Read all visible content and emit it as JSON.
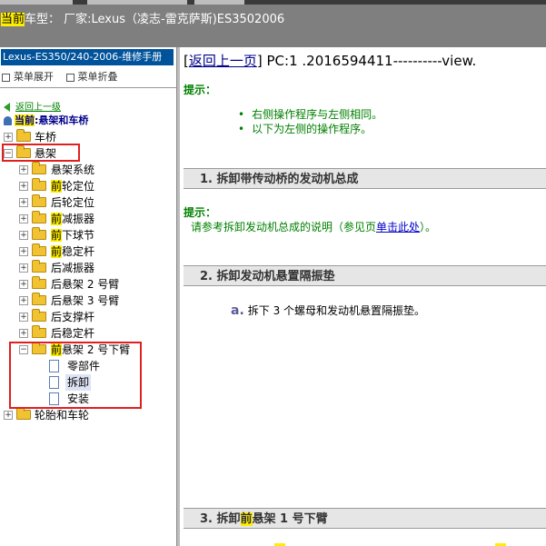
{
  "header": {
    "prefix_highlight": "当前",
    "rest": "车型：  厂家:Lexus（凌志-雷克萨斯)ES3502006"
  },
  "sidebar": {
    "manual_title": "Lexus-ES350/240-2006-维修手册",
    "expand_label": "菜单展开",
    "collapse_label": "菜单折叠",
    "back_label": "返回上一级",
    "current_prefix": "当前",
    "current_label": ":悬架和车桥",
    "tree": [
      {
        "label": "车桥"
      },
      {
        "label": "悬架"
      },
      {
        "label": "悬架系统"
      },
      {
        "hl": "前",
        "label": "轮定位"
      },
      {
        "label": "后轮定位"
      },
      {
        "hl": "前",
        "label": "减振器"
      },
      {
        "hl": "前",
        "label": "下球节"
      },
      {
        "hl": "前",
        "label": "稳定杆"
      },
      {
        "label": "后减振器"
      },
      {
        "label": "后悬架 2 号臂"
      },
      {
        "label": "后悬架 3 号臂"
      },
      {
        "label": "后支撑杆"
      },
      {
        "label": "后稳定杆"
      },
      {
        "hl": "前",
        "label": "悬架 2 号下臂"
      },
      {
        "label": "零部件"
      },
      {
        "label": "拆卸"
      },
      {
        "label": "安装"
      },
      {
        "label": "轮胎和车轮"
      }
    ]
  },
  "main": {
    "back_link": "返回上一页",
    "pc_text": "PC:1 .2016594411----------view.",
    "tip_label": "提示：",
    "bullets": [
      "右侧操作程序与左侧相同。",
      "以下为左侧的操作程序。"
    ],
    "section1": "1. 拆卸带传动桥的发动机总成",
    "tip2_label": "提示：",
    "note_text": "请参考拆卸发动机总成的说明（参见页",
    "note_link": "单击此处",
    "note_end": "）。",
    "section2": "2. 拆卸发动机悬置隔振垫",
    "step_letter": "a.",
    "step_text": "拆下 3 个螺母和发动机悬置隔振垫。",
    "section3_prefix": "3. 拆卸",
    "section3_hl": "前",
    "section3_rest": "悬架 1 号下臂"
  }
}
